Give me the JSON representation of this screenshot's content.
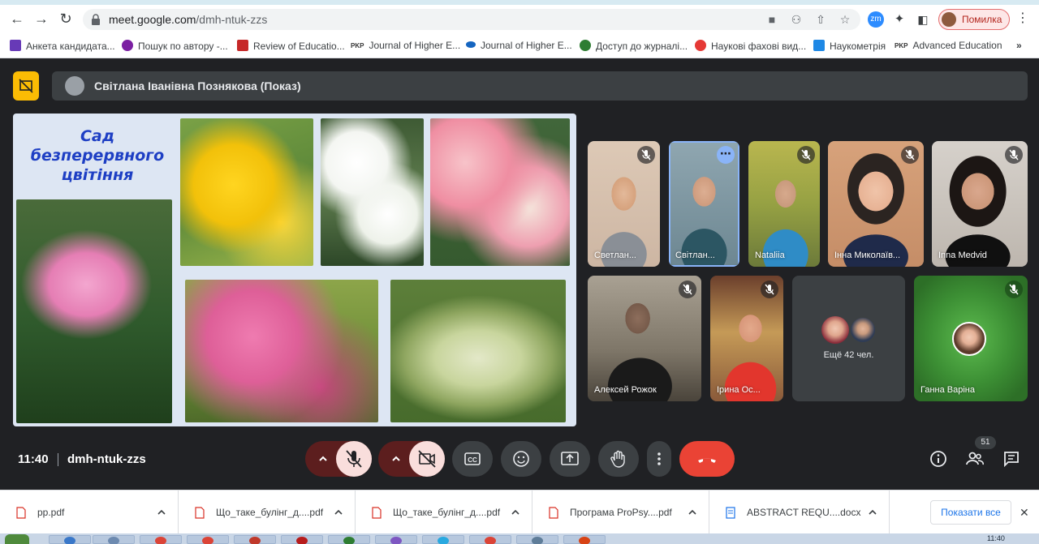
{
  "browser": {
    "url_host": "meet.google.com",
    "url_path": "/dmh-ntuk-zzs",
    "profile_label": "Помилка",
    "extension_label": "zm"
  },
  "bookmarks": [
    {
      "label": "Анкета кандидата...",
      "icon": "forms-icon",
      "color": "#673ab7"
    },
    {
      "label": "Пошук по автору -...",
      "icon": "scopus-icon",
      "color": "#7b1fa2"
    },
    {
      "label": "Review of Educatio...",
      "icon": "grid-icon",
      "color": "#c62828"
    },
    {
      "label": "Journal of Higher E...",
      "icon": "pkp-icon",
      "color": "#333333"
    },
    {
      "label": "Journal of Higher E...",
      "icon": "check-icon",
      "color": "#1565c0"
    },
    {
      "label": "Доступ до журналі...",
      "icon": "crest-icon",
      "color": "#2e7d32"
    },
    {
      "label": "Наукові фахові вид...",
      "icon": "dots-icon",
      "color": "#e53935"
    },
    {
      "label": "Наукометрія",
      "icon": "puzzle-icon",
      "color": "#1e88e5"
    },
    {
      "label": "Advanced Education",
      "icon": "pkp-icon",
      "color": "#333333"
    }
  ],
  "meet": {
    "presenter_label": "Світлана Іванівна Познякова (Показ)",
    "slide_title": "Сад безперервного цвітіння",
    "participants": [
      {
        "name": "Светлан...",
        "muted": true
      },
      {
        "name": "Світлан...",
        "muted": false,
        "speaking": true
      },
      {
        "name": "Nataliia",
        "muted": true
      },
      {
        "name": "Інна Миколаїв...",
        "muted": true
      },
      {
        "name": "Inna Medvid",
        "muted": true
      },
      {
        "name": "Алексей Рожок",
        "muted": true
      },
      {
        "name": "Ірина Ос...",
        "muted": true
      },
      {
        "name": "Ганна Варіна",
        "muted": true
      }
    ],
    "others_label": "Ещё 42 чел.",
    "time": "11:40",
    "meeting_code": "dmh-ntuk-zzs",
    "people_count": "51"
  },
  "downloads": {
    "files": [
      "pp.pdf",
      "Що_таке_булінг_д....pdf",
      "Що_таке_булінг_д....pdf",
      "Програма ProPsy....pdf",
      "ABSTRACT REQU....docx"
    ],
    "show_all": "Показати все"
  },
  "taskbar": {
    "time": "11:40"
  },
  "colors": {
    "accent": "#fbbc04",
    "hangup": "#ea4335",
    "mic_off_bg": "#f9dedc"
  }
}
